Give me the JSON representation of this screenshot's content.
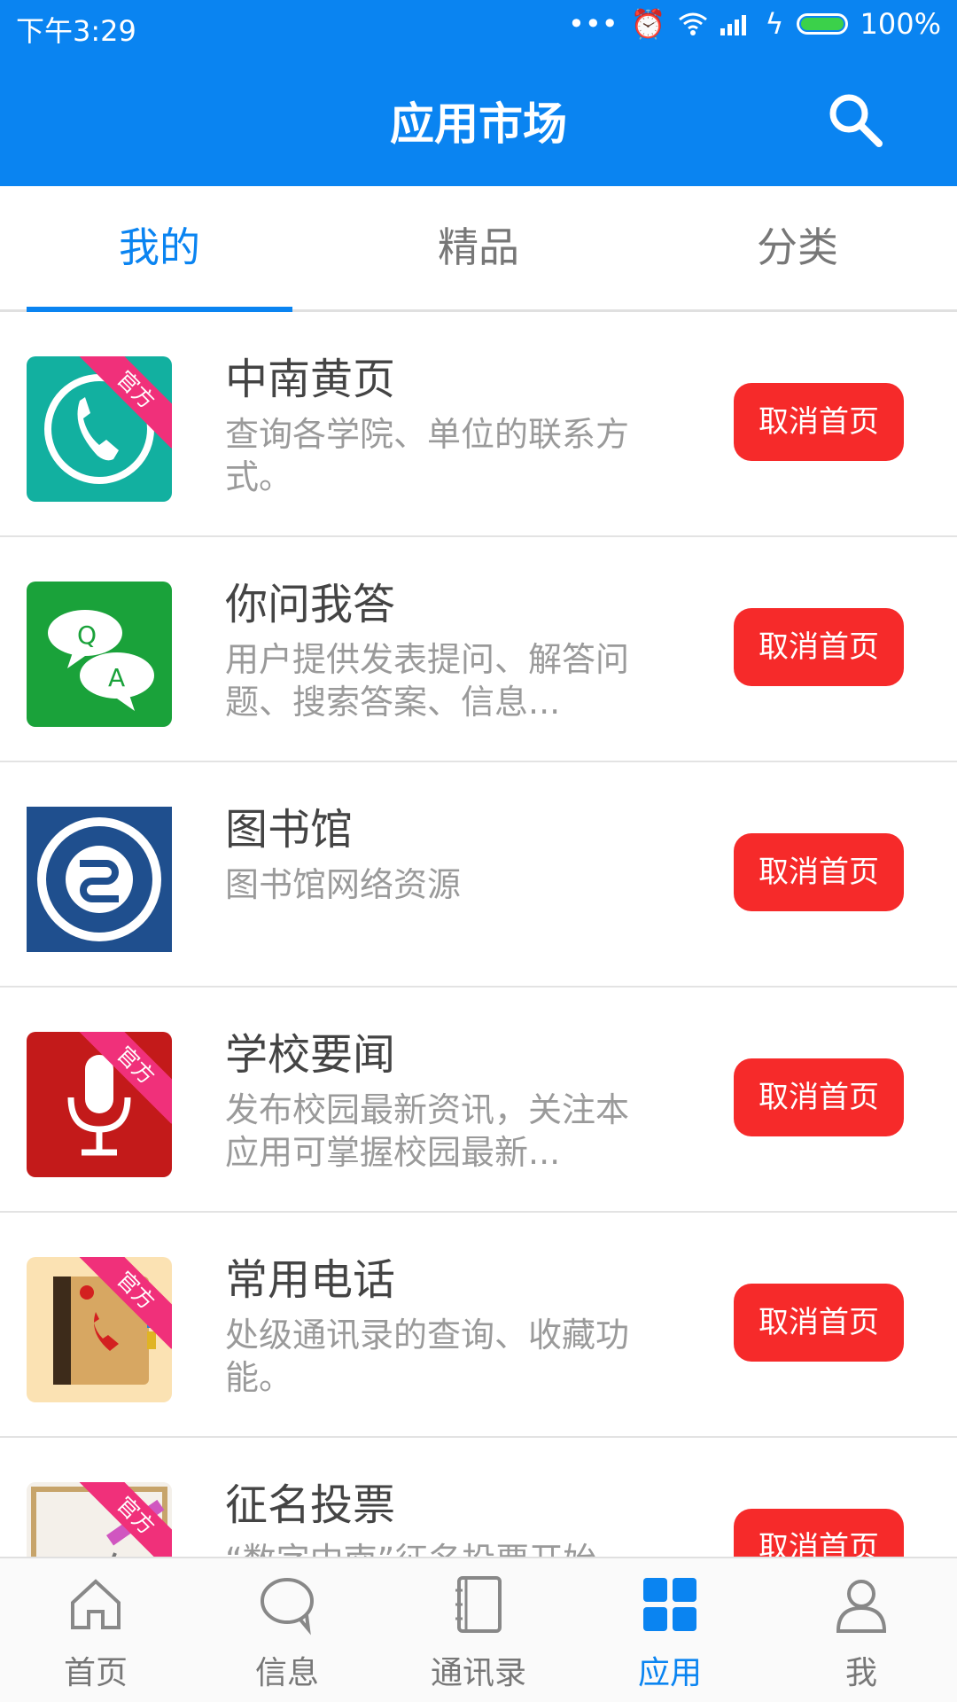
{
  "status": {
    "time": "下午3:29",
    "battery": "100%"
  },
  "header": {
    "title": "应用市场"
  },
  "tabs": [
    {
      "label": "我的",
      "active": true
    },
    {
      "label": "精品",
      "active": false
    },
    {
      "label": "分类",
      "active": false
    }
  ],
  "apps": [
    {
      "name": "中南黄页",
      "desc": "查询各学院、单位的联系方式。",
      "button": "取消首页",
      "badge": "官方",
      "icon": "phone-icon"
    },
    {
      "name": "你问我答",
      "desc": "用户提供发表提问、解答问题、搜索答案、信息...",
      "button": "取消首页",
      "badge": "",
      "icon": "qa-chat-icon"
    },
    {
      "name": "图书馆",
      "desc": "图书馆网络资源",
      "button": "取消首页",
      "badge": "",
      "icon": "university-seal-icon"
    },
    {
      "name": "学校要闻",
      "desc": "发布校园最新资讯，关注本应用可掌握校园最新...",
      "button": "取消首页",
      "badge": "官方",
      "icon": "microphone-icon"
    },
    {
      "name": "常用电话",
      "desc": "处级通讯录的查询、收藏功能。",
      "button": "取消首页",
      "badge": "官方",
      "icon": "phonebook-icon"
    },
    {
      "name": "征名投票",
      "desc": "“数字中南”征名投票开始...",
      "button": "取消首页",
      "badge": "官方",
      "icon": "signature-pen-icon"
    }
  ],
  "bottom_nav": [
    {
      "label": "首页",
      "icon": "home-icon",
      "active": false
    },
    {
      "label": "信息",
      "icon": "chat-bubble-icon",
      "active": false
    },
    {
      "label": "通讯录",
      "icon": "contacts-book-icon",
      "active": false
    },
    {
      "label": "应用",
      "icon": "grid-apps-icon",
      "active": true
    },
    {
      "label": "我",
      "icon": "person-icon",
      "active": false
    }
  ],
  "colors": {
    "primary": "#0a84f1",
    "button": "#f62a2a",
    "badge": "#f0307a"
  }
}
